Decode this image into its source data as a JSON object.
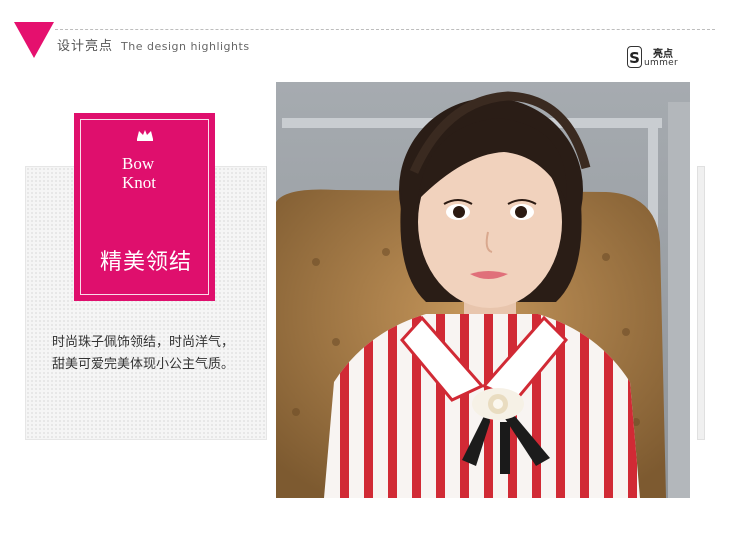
{
  "header": {
    "title_zh": "设计亮点",
    "title_en": "The design highlights"
  },
  "logo": {
    "letter": "S",
    "zh": "亮点",
    "en": "ummer"
  },
  "feature": {
    "title_en_line1": "Bow",
    "title_en_line2": "Knot",
    "title_zh": "精美领结",
    "desc_line1": "时尚珠子佩饰领结，时尚洋气，",
    "desc_line2": "甜美可爱完美体现小公主气质。"
  },
  "colors": {
    "accent": "#df0f6d"
  }
}
